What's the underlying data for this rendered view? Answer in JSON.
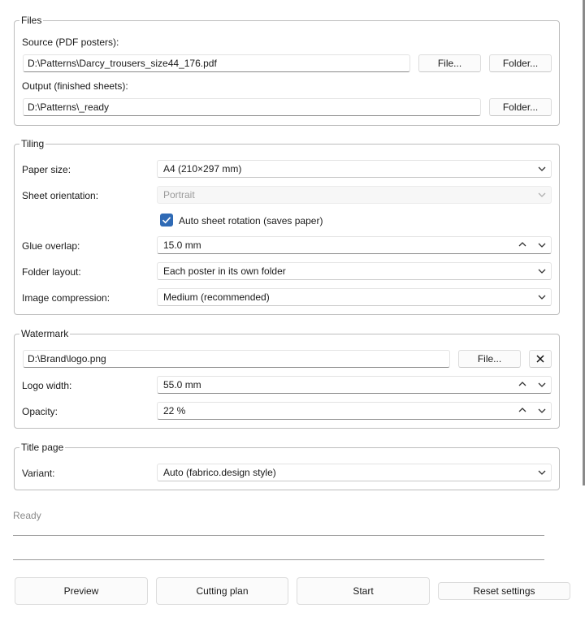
{
  "files": {
    "title": "Files",
    "source_label": "Source (PDF posters):",
    "source_value": "D:\\Patterns\\Darcy_trousers_size44_176.pdf",
    "source_file_button": "File...",
    "source_folder_button": "Folder...",
    "output_label": "Output (finished sheets):",
    "output_value": "D:\\Patterns\\_ready",
    "output_folder_button": "Folder..."
  },
  "tiling": {
    "title": "Tiling",
    "paper_size_label": "Paper size:",
    "paper_size_value": "A4 (210×297 mm)",
    "orientation_label": "Sheet orientation:",
    "orientation_value": "Portrait",
    "orientation_enabled": false,
    "auto_rotation_label": "Auto sheet rotation (saves paper)",
    "auto_rotation_checked": true,
    "glue_overlap_label": "Glue overlap:",
    "glue_overlap_value": "15.0 mm",
    "folder_layout_label": "Folder layout:",
    "folder_layout_value": "Each poster in its own folder",
    "compression_label": "Image compression:",
    "compression_value": "Medium (recommended)"
  },
  "watermark": {
    "title": "Watermark",
    "logo_path": "D:\\Brand\\logo.png",
    "file_button": "File...",
    "clear_button": "✕",
    "logo_width_label": "Logo width:",
    "logo_width_value": "55.0 mm",
    "opacity_label": "Opacity:",
    "opacity_value": "22 %"
  },
  "title_page": {
    "title": "Title page",
    "variant_label": "Variant:",
    "variant_value": "Auto (fabrico.design style)"
  },
  "status": {
    "text": "Ready"
  },
  "actions": {
    "preview": "Preview",
    "cutting_plan": "Cutting plan",
    "start": "Start",
    "reset": "Reset settings"
  },
  "icons": {
    "dropdown": "chevron-down-icon",
    "spin_up": "chevron-up-icon",
    "checkbox": "checkmark-icon"
  }
}
